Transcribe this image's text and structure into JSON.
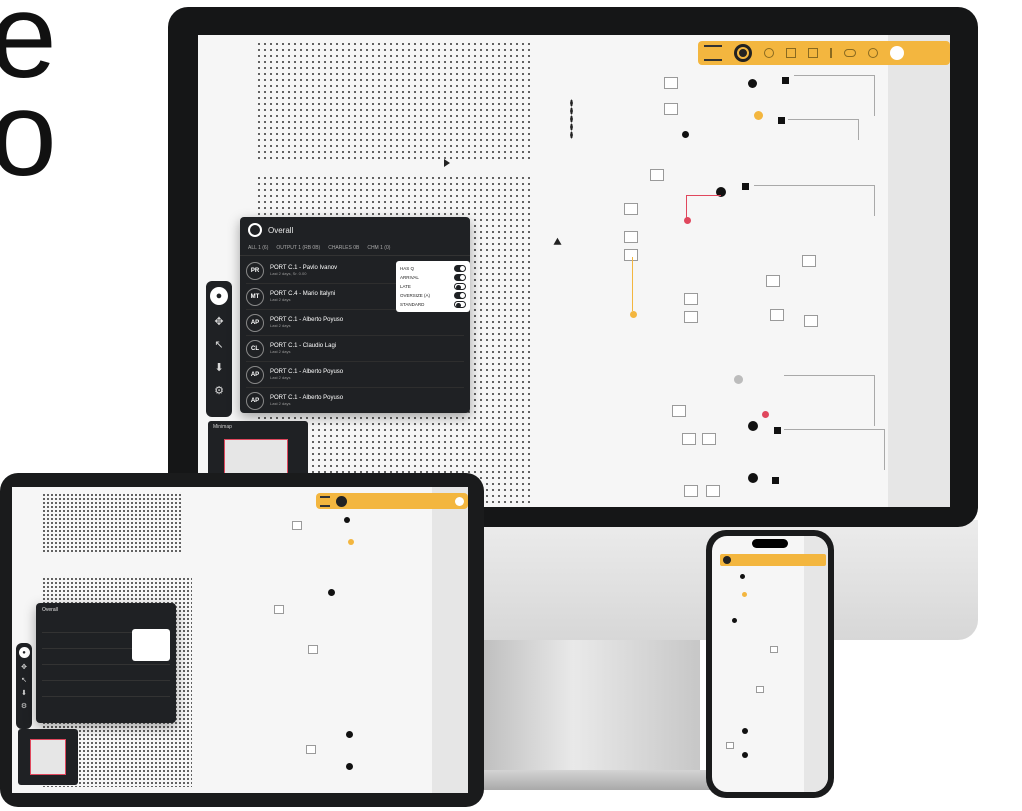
{
  "headline_fragment": {
    "line1": "e",
    "line2": "o"
  },
  "toolbar": {
    "bg_color": "#f3b63f",
    "icons": [
      "menu-icon",
      "bell-icon",
      "search-icon",
      "share-icon",
      "grid-icon",
      "bolt-icon",
      "cloud-icon",
      "settings-icon",
      "user-icon"
    ]
  },
  "panel": {
    "title": "Overall",
    "tabs": [
      "ALL 1 (6)",
      "OUTPUT 1 (RB 0B)",
      "CHARLES 0B",
      "CHM 1 (0)"
    ],
    "rows": [
      {
        "initials": "PR",
        "title": "PORT C.1 - Pavlo Ivanov",
        "subtitle": "Last 2 days, Sr. 0.00"
      },
      {
        "initials": "MT",
        "title": "PORT C.4 - Mario Italyni",
        "subtitle": "Last 2 days"
      },
      {
        "initials": "AP",
        "title": "PORT C.1 - Alberto Poyuso",
        "subtitle": "Last 2 days"
      },
      {
        "initials": "CL",
        "title": "PORT C.1 - Claudio Lagi",
        "subtitle": "Last 2 days"
      },
      {
        "initials": "AP",
        "title": "PORT C.1 - Alberto Poyuso",
        "subtitle": "Last 2 days"
      },
      {
        "initials": "AP",
        "title": "PORT C.1 - Alberto Poyuso",
        "subtitle": "Last 2 days"
      }
    ],
    "legend": [
      {
        "label": "HAS Q",
        "on": true
      },
      {
        "label": "ARRIVAL",
        "on": true
      },
      {
        "label": "LATE",
        "on": false
      },
      {
        "label": "OVERSIZE (A)",
        "on": true
      },
      {
        "label": "STANDARD",
        "on": false
      }
    ]
  },
  "minimap": {
    "title": "Minimap"
  },
  "rail_icons": [
    "user-icon",
    "move-icon",
    "pointer-icon",
    "pin-icon",
    "settings-icon"
  ]
}
